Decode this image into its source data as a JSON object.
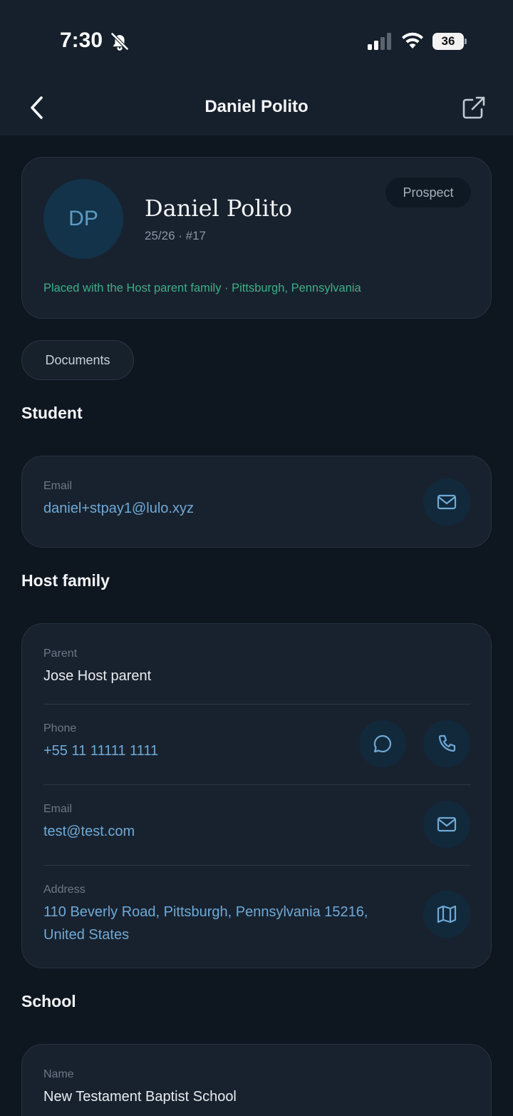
{
  "status_bar": {
    "time": "7:30",
    "battery": "36"
  },
  "nav": {
    "title": "Daniel Polito"
  },
  "profile": {
    "initials": "DP",
    "name": "Daniel Polito",
    "subtitle": "25/26 · #17",
    "badge": "Prospect",
    "placement": "Placed with the Host parent family · Pittsburgh, Pennsylvania"
  },
  "documents_label": "Documents",
  "student": {
    "title": "Student",
    "email_label": "Email",
    "email": "daniel+stpay1@lulo.xyz"
  },
  "host_family": {
    "title": "Host family",
    "parent_label": "Parent",
    "parent": "Jose Host parent",
    "phone_label": "Phone",
    "phone": "+55 11 11111 1111",
    "email_label": "Email",
    "email": "test@test.com",
    "address_label": "Address",
    "address_line1": "110 Beverly Road, Pittsburgh, Pennsylvania 15216,",
    "address_line2": "United States"
  },
  "school": {
    "title": "School",
    "name_label": "Name",
    "name": "New Testament Baptist School"
  },
  "colors": {
    "accent": "#6fa9d6",
    "placement": "#3fae86",
    "background": "#0e1620",
    "card": "#18222e"
  }
}
